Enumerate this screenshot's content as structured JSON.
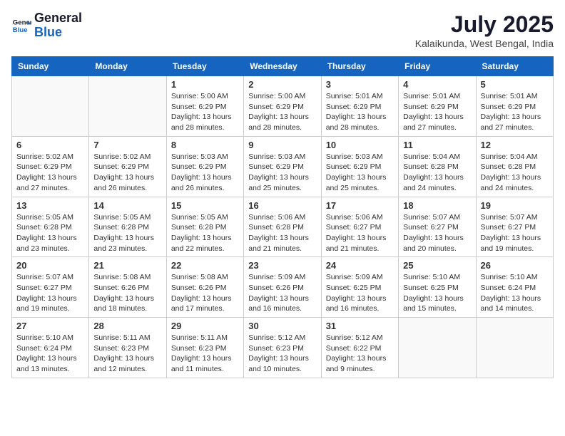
{
  "logo": {
    "line1": "General",
    "line2": "Blue"
  },
  "title": "July 2025",
  "location": "Kalaikunda, West Bengal, India",
  "headers": [
    "Sunday",
    "Monday",
    "Tuesday",
    "Wednesday",
    "Thursday",
    "Friday",
    "Saturday"
  ],
  "weeks": [
    [
      {
        "num": "",
        "detail": ""
      },
      {
        "num": "",
        "detail": ""
      },
      {
        "num": "1",
        "detail": "Sunrise: 5:00 AM\nSunset: 6:29 PM\nDaylight: 13 hours\nand 28 minutes."
      },
      {
        "num": "2",
        "detail": "Sunrise: 5:00 AM\nSunset: 6:29 PM\nDaylight: 13 hours\nand 28 minutes."
      },
      {
        "num": "3",
        "detail": "Sunrise: 5:01 AM\nSunset: 6:29 PM\nDaylight: 13 hours\nand 28 minutes."
      },
      {
        "num": "4",
        "detail": "Sunrise: 5:01 AM\nSunset: 6:29 PM\nDaylight: 13 hours\nand 27 minutes."
      },
      {
        "num": "5",
        "detail": "Sunrise: 5:01 AM\nSunset: 6:29 PM\nDaylight: 13 hours\nand 27 minutes."
      }
    ],
    [
      {
        "num": "6",
        "detail": "Sunrise: 5:02 AM\nSunset: 6:29 PM\nDaylight: 13 hours\nand 27 minutes."
      },
      {
        "num": "7",
        "detail": "Sunrise: 5:02 AM\nSunset: 6:29 PM\nDaylight: 13 hours\nand 26 minutes."
      },
      {
        "num": "8",
        "detail": "Sunrise: 5:03 AM\nSunset: 6:29 PM\nDaylight: 13 hours\nand 26 minutes."
      },
      {
        "num": "9",
        "detail": "Sunrise: 5:03 AM\nSunset: 6:29 PM\nDaylight: 13 hours\nand 25 minutes."
      },
      {
        "num": "10",
        "detail": "Sunrise: 5:03 AM\nSunset: 6:29 PM\nDaylight: 13 hours\nand 25 minutes."
      },
      {
        "num": "11",
        "detail": "Sunrise: 5:04 AM\nSunset: 6:28 PM\nDaylight: 13 hours\nand 24 minutes."
      },
      {
        "num": "12",
        "detail": "Sunrise: 5:04 AM\nSunset: 6:28 PM\nDaylight: 13 hours\nand 24 minutes."
      }
    ],
    [
      {
        "num": "13",
        "detail": "Sunrise: 5:05 AM\nSunset: 6:28 PM\nDaylight: 13 hours\nand 23 minutes."
      },
      {
        "num": "14",
        "detail": "Sunrise: 5:05 AM\nSunset: 6:28 PM\nDaylight: 13 hours\nand 23 minutes."
      },
      {
        "num": "15",
        "detail": "Sunrise: 5:05 AM\nSunset: 6:28 PM\nDaylight: 13 hours\nand 22 minutes."
      },
      {
        "num": "16",
        "detail": "Sunrise: 5:06 AM\nSunset: 6:28 PM\nDaylight: 13 hours\nand 21 minutes."
      },
      {
        "num": "17",
        "detail": "Sunrise: 5:06 AM\nSunset: 6:27 PM\nDaylight: 13 hours\nand 21 minutes."
      },
      {
        "num": "18",
        "detail": "Sunrise: 5:07 AM\nSunset: 6:27 PM\nDaylight: 13 hours\nand 20 minutes."
      },
      {
        "num": "19",
        "detail": "Sunrise: 5:07 AM\nSunset: 6:27 PM\nDaylight: 13 hours\nand 19 minutes."
      }
    ],
    [
      {
        "num": "20",
        "detail": "Sunrise: 5:07 AM\nSunset: 6:27 PM\nDaylight: 13 hours\nand 19 minutes."
      },
      {
        "num": "21",
        "detail": "Sunrise: 5:08 AM\nSunset: 6:26 PM\nDaylight: 13 hours\nand 18 minutes."
      },
      {
        "num": "22",
        "detail": "Sunrise: 5:08 AM\nSunset: 6:26 PM\nDaylight: 13 hours\nand 17 minutes."
      },
      {
        "num": "23",
        "detail": "Sunrise: 5:09 AM\nSunset: 6:26 PM\nDaylight: 13 hours\nand 16 minutes."
      },
      {
        "num": "24",
        "detail": "Sunrise: 5:09 AM\nSunset: 6:25 PM\nDaylight: 13 hours\nand 16 minutes."
      },
      {
        "num": "25",
        "detail": "Sunrise: 5:10 AM\nSunset: 6:25 PM\nDaylight: 13 hours\nand 15 minutes."
      },
      {
        "num": "26",
        "detail": "Sunrise: 5:10 AM\nSunset: 6:24 PM\nDaylight: 13 hours\nand 14 minutes."
      }
    ],
    [
      {
        "num": "27",
        "detail": "Sunrise: 5:10 AM\nSunset: 6:24 PM\nDaylight: 13 hours\nand 13 minutes."
      },
      {
        "num": "28",
        "detail": "Sunrise: 5:11 AM\nSunset: 6:23 PM\nDaylight: 13 hours\nand 12 minutes."
      },
      {
        "num": "29",
        "detail": "Sunrise: 5:11 AM\nSunset: 6:23 PM\nDaylight: 13 hours\nand 11 minutes."
      },
      {
        "num": "30",
        "detail": "Sunrise: 5:12 AM\nSunset: 6:23 PM\nDaylight: 13 hours\nand 10 minutes."
      },
      {
        "num": "31",
        "detail": "Sunrise: 5:12 AM\nSunset: 6:22 PM\nDaylight: 13 hours\nand 9 minutes."
      },
      {
        "num": "",
        "detail": ""
      },
      {
        "num": "",
        "detail": ""
      }
    ]
  ]
}
